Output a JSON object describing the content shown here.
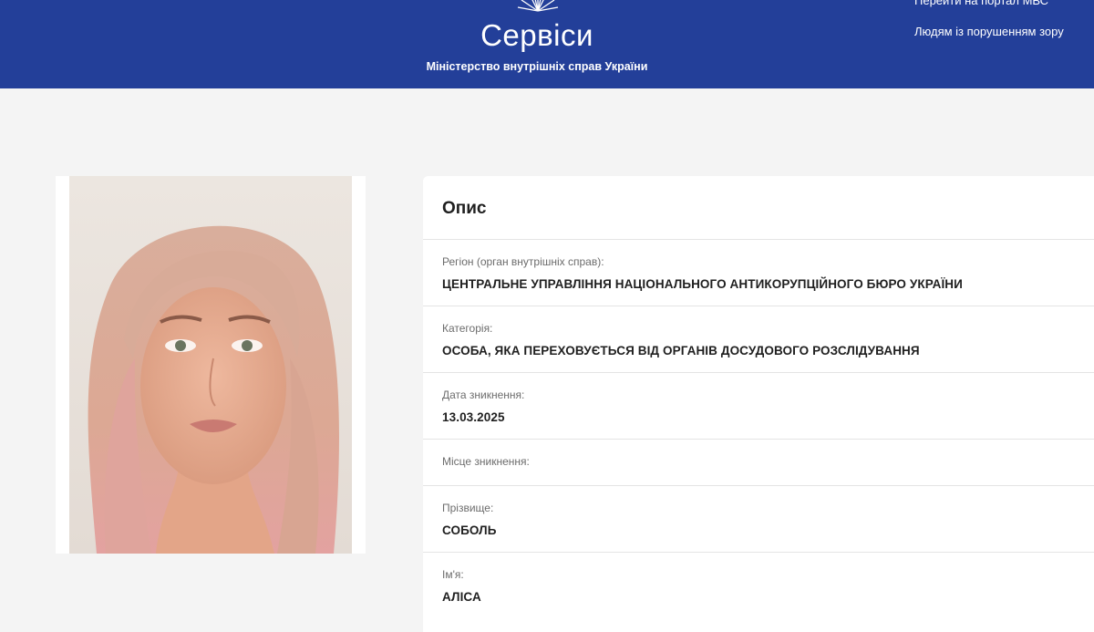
{
  "header": {
    "title": "Сервіси",
    "subtitle": "Міністерство внутрішніх справ України",
    "nav": {
      "portal": "Перейти на портал МВС",
      "accessibility": "Людям із порушенням зору"
    },
    "color": "#233f99"
  },
  "photo": {
    "description_icon": "person-photo"
  },
  "card": {
    "title": "Опис",
    "fields": [
      {
        "label": "Регіон (орган внутрішніх справ):",
        "value": "ЦЕНТРАЛЬНЕ УПРАВЛІННЯ НАЦІОНАЛЬНОГО АНТИКОРУПЦІЙНОГО БЮРО УКРАЇНИ"
      },
      {
        "label": "Категорія:",
        "value": "ОСОБА, ЯКА ПЕРЕХОВУЄТЬСЯ ВІД ОРГАНІВ ДОСУДОВОГО РОЗСЛІДУВАННЯ"
      },
      {
        "label": "Дата зникнення:",
        "value": "13.03.2025"
      },
      {
        "label": "Місце зникнення:",
        "value": ""
      },
      {
        "label": "Прізвище:",
        "value": "СОБОЛЬ"
      },
      {
        "label": "Ім'я:",
        "value": "АЛІСА"
      }
    ]
  }
}
